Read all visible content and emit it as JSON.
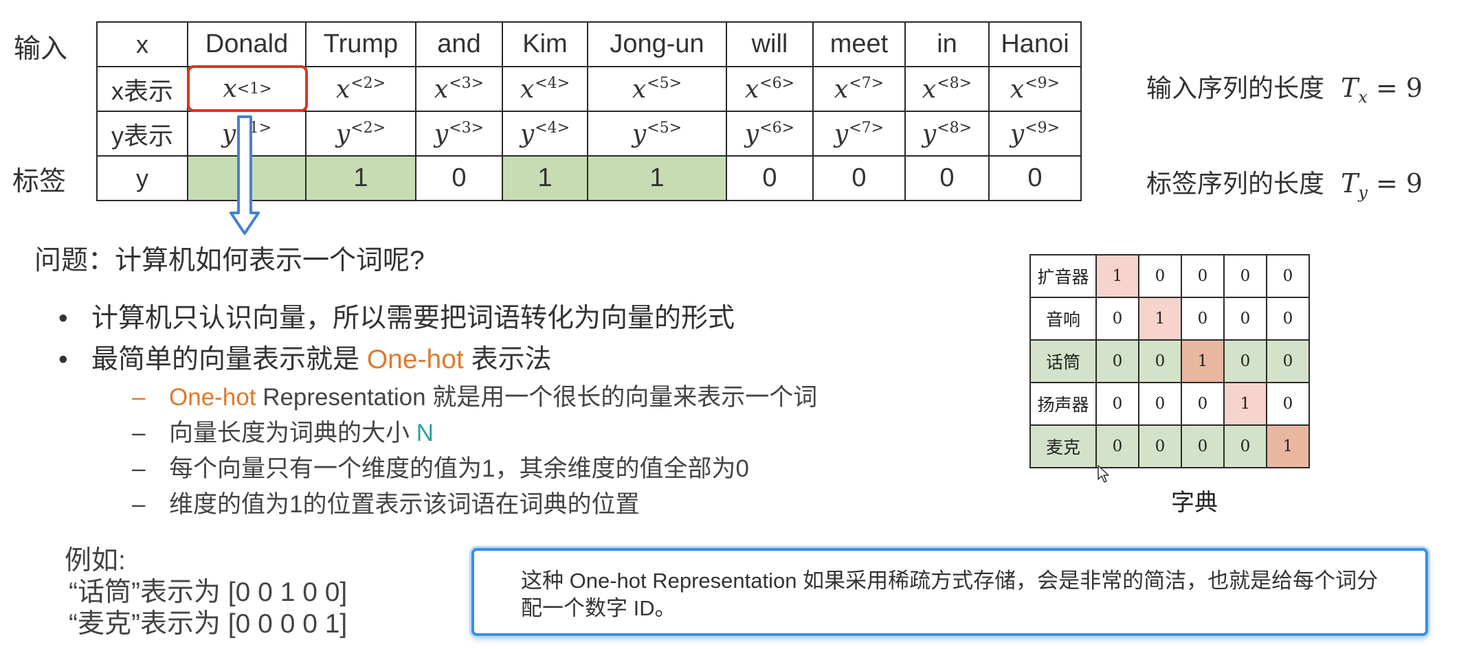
{
  "side_labels": {
    "input": "输入",
    "label": "标签"
  },
  "seq_table": {
    "row_words": {
      "label": "x",
      "cells": [
        "Donald",
        "Trump",
        "and",
        "Kim",
        "Jong-un",
        "will",
        "meet",
        "in",
        "Hanoi"
      ]
    },
    "row_x": {
      "label": "x表示",
      "base": "x",
      "sups": [
        "<1>",
        "<2>",
        "<3>",
        "<4>",
        "<5>",
        "<6>",
        "<7>",
        "<8>",
        "<9>"
      ]
    },
    "row_yrep": {
      "label": "y表示",
      "base": "y",
      "sups": [
        "<1>",
        "<2>",
        "<3>",
        "<4>",
        "<5>",
        "<6>",
        "<7>",
        "<8>",
        "<9>"
      ]
    },
    "row_y": {
      "label": "y",
      "values": [
        "",
        "1",
        "0",
        "1",
        "1",
        "0",
        "0",
        "0",
        "0"
      ]
    },
    "highlight_green_columns": [
      0,
      1,
      3,
      4
    ],
    "highlight_color": "#c7dcb3",
    "selected_cell_border_color": "#e0321f"
  },
  "metrics": [
    {
      "label": "输入序列的长度",
      "base": "T",
      "sub": "x",
      "rhs": "= 9"
    },
    {
      "label": "标签序列的长度",
      "base": "T",
      "sub": "y",
      "rhs": "= 9"
    }
  ],
  "question": "问题：计算机如何表示一个词呢?",
  "bullets": [
    {
      "dot": "•",
      "text": "计算机只认识向量，所以需要把词语转化为向量的形式"
    },
    {
      "dot": "•",
      "pre": "最简单的向量表示就是 ",
      "accent": "One-hot",
      "post": " 表示法"
    }
  ],
  "sub_bullets": [
    {
      "dash": "–",
      "accent": "One-hot",
      "text": " Representation 就是用一个很长的向量来表示一个词"
    },
    {
      "dash": "–",
      "text": "向量长度为词典的大小 ",
      "accent_teal": "N"
    },
    {
      "dash": "–",
      "text": "每个向量只有一个维度的值为1，其余维度的值全部为0"
    },
    {
      "dash": "–",
      "text": "维度的值为1的位置表示该词语在词典的位置"
    }
  ],
  "example": {
    "title": "例如:",
    "lines": [
      "“话筒”表示为 [0 0 1 0 0]",
      "“麦克”表示为 [0 0 0 0 1]"
    ]
  },
  "dictionary": {
    "caption": "字典",
    "rows": [
      {
        "word": "扩音器",
        "values": [
          "1",
          "0",
          "0",
          "0",
          "0"
        ]
      },
      {
        "word": "音响",
        "values": [
          "0",
          "1",
          "0",
          "0",
          "0"
        ]
      },
      {
        "word": "话筒",
        "values": [
          "0",
          "0",
          "1",
          "0",
          "0"
        ]
      },
      {
        "word": "扬声器",
        "values": [
          "0",
          "0",
          "0",
          "1",
          "0"
        ]
      },
      {
        "word": "麦克",
        "values": [
          "0",
          "0",
          "0",
          "0",
          "1"
        ]
      }
    ],
    "green_rows": [
      2,
      4
    ],
    "hot_color": "#e9b6a0",
    "pink_color": "#f6d3cb",
    "green_color": "#d3e2c8"
  },
  "subtitle_caption": "这种 One-hot Representation 如果采用稀疏方式存储，会是非常的简洁，也就是给每个词分配一个数字 ID。",
  "colors": {
    "accent_orange": "#e07a2a",
    "accent_teal": "#2aa39a",
    "caption_border": "#3a8fe0",
    "arrow_blue": "#4a7fd0"
  }
}
